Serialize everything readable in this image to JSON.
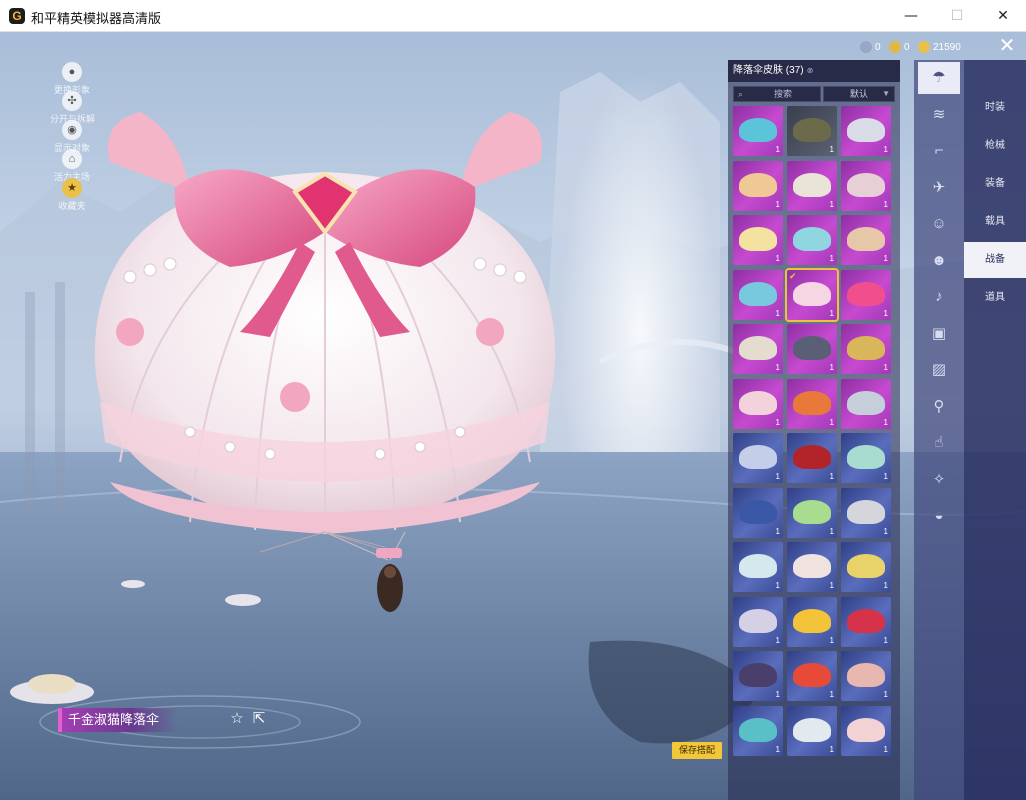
{
  "window": {
    "title": "和平精英模拟器高清版",
    "logo": "G"
  },
  "currencies": [
    {
      "icon": "coupon-icon",
      "value": "0",
      "color": "#9aa6c7"
    },
    {
      "icon": "medal-icon",
      "value": "0",
      "color": "#e0b84a"
    },
    {
      "icon": "gold-coin-icon",
      "value": "21590",
      "color": "#e8c04a"
    }
  ],
  "quick_actions": [
    {
      "icon": "avatar-icon",
      "label": "更换形象"
    },
    {
      "icon": "split-icon",
      "label": "分开与拆解"
    },
    {
      "icon": "eye-icon",
      "label": "显示对象"
    },
    {
      "icon": "home-icon",
      "label": "活力主场"
    },
    {
      "icon": "collection-icon",
      "label": "收藏夹"
    }
  ],
  "item": {
    "name": "千金淑猫降落伞"
  },
  "panel": {
    "title": "降落伞皮肤",
    "count": "(37)",
    "search_placeholder": "搜索",
    "sort_label": "默认"
  },
  "skins": [
    {
      "tier": "purple",
      "color": "#5bc4d8",
      "count": "1"
    },
    {
      "tier": "gray",
      "color": "#6b6a4a",
      "count": "1"
    },
    {
      "tier": "purple",
      "color": "#d9dbe6",
      "count": "1"
    },
    {
      "tier": "purple",
      "color": "#f0c896",
      "count": "1"
    },
    {
      "tier": "purple",
      "color": "#e9e3d8",
      "count": "1"
    },
    {
      "tier": "purple",
      "color": "#e6d0d6",
      "count": "1"
    },
    {
      "tier": "purple",
      "color": "#f4e3a0",
      "count": "1"
    },
    {
      "tier": "purple",
      "color": "#8fd6e0",
      "count": "1"
    },
    {
      "tier": "purple",
      "color": "#e6c8a8",
      "count": "1"
    },
    {
      "tier": "purple",
      "color": "#77c9de",
      "count": "1"
    },
    {
      "tier": "purple",
      "color": "#f6d6e2",
      "count": "1",
      "selected": true
    },
    {
      "tier": "purple",
      "color": "#f14e8e",
      "count": "1"
    },
    {
      "tier": "purple",
      "color": "#e4dccf",
      "count": "1"
    },
    {
      "tier": "purple",
      "color": "#5a5f76",
      "count": "1"
    },
    {
      "tier": "purple",
      "color": "#d9b65a",
      "count": "1"
    },
    {
      "tier": "purple",
      "color": "#f2d3dc",
      "count": "1"
    },
    {
      "tier": "purple",
      "color": "#e8793a",
      "count": "1"
    },
    {
      "tier": "purple",
      "color": "#c6cfd9",
      "count": "1"
    },
    {
      "tier": "blue",
      "color": "#c5cee8",
      "count": "1"
    },
    {
      "tier": "blue",
      "color": "#b3242a",
      "count": "1"
    },
    {
      "tier": "blue",
      "color": "#a9dcd0",
      "count": "1"
    },
    {
      "tier": "blue",
      "color": "#3a58a6",
      "count": "1"
    },
    {
      "tier": "blue",
      "color": "#a8dc8e",
      "count": "1"
    },
    {
      "tier": "blue",
      "color": "#d4d6dc",
      "count": "1"
    },
    {
      "tier": "blue",
      "color": "#d4e8ee",
      "count": "1"
    },
    {
      "tier": "blue",
      "color": "#f0e2df",
      "count": "1"
    },
    {
      "tier": "blue",
      "color": "#e7d36a",
      "count": "1"
    },
    {
      "tier": "blue",
      "color": "#d6d0e4",
      "count": "1"
    },
    {
      "tier": "blue",
      "color": "#f3c33a",
      "count": "1"
    },
    {
      "tier": "blue",
      "color": "#d6324a",
      "count": "1"
    },
    {
      "tier": "blue",
      "color": "#4a3e6a",
      "count": "1"
    },
    {
      "tier": "blue",
      "color": "#e84a3a",
      "count": "1"
    },
    {
      "tier": "blue",
      "color": "#e8b8b0",
      "count": "1"
    },
    {
      "tier": "blue",
      "color": "#5ac0c8",
      "count": "1"
    },
    {
      "tier": "blue",
      "color": "#e2eaf0",
      "count": "1"
    },
    {
      "tier": "blue",
      "color": "#f3d2d6",
      "count": "1"
    }
  ],
  "save_button": "保存搭配",
  "categories_icons": [
    {
      "icon": "parachute-icon",
      "active": true
    },
    {
      "icon": "wings-icon",
      "active": false
    },
    {
      "icon": "gun-icon",
      "active": false
    },
    {
      "icon": "plane-icon",
      "active": false
    },
    {
      "icon": "emote-icon",
      "active": false
    },
    {
      "icon": "robot-icon",
      "active": false
    },
    {
      "icon": "sound-icon",
      "active": false
    },
    {
      "icon": "box-icon",
      "active": false
    },
    {
      "icon": "picture-icon",
      "active": false
    },
    {
      "icon": "spray-icon",
      "active": false
    },
    {
      "icon": "gesture-icon",
      "active": false
    },
    {
      "icon": "wand-icon",
      "active": false
    },
    {
      "icon": "shell-icon",
      "active": false
    }
  ],
  "categories": [
    {
      "label": "时装",
      "active": false
    },
    {
      "label": "枪械",
      "active": false
    },
    {
      "label": "装备",
      "active": false
    },
    {
      "label": "载具",
      "active": false
    },
    {
      "label": "战备",
      "active": true
    },
    {
      "label": "道具",
      "active": false
    }
  ]
}
